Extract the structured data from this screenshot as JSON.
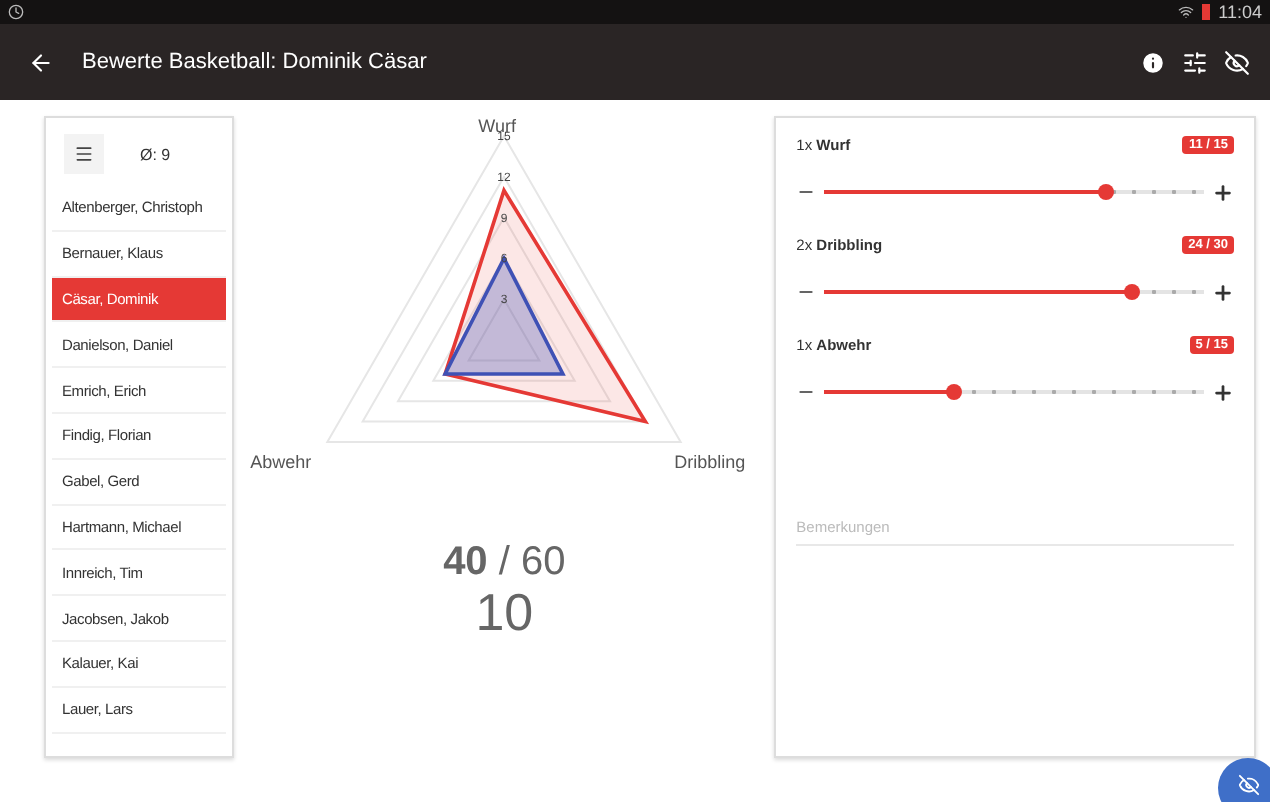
{
  "status_bar": {
    "time": "11:04"
  },
  "app_bar": {
    "title": "Bewerte Basketball: Dominik Cäsar"
  },
  "student_list": {
    "average": "Ø: 9",
    "students": [
      {
        "name": "Altenberger, Christoph",
        "selected": false
      },
      {
        "name": "Bernauer, Klaus",
        "selected": false
      },
      {
        "name": "Cäsar, Dominik",
        "selected": true
      },
      {
        "name": "Danielson, Daniel",
        "selected": false
      },
      {
        "name": "Emrich, Erich",
        "selected": false
      },
      {
        "name": "Findig, Florian",
        "selected": false
      },
      {
        "name": "Gabel, Gerd",
        "selected": false
      },
      {
        "name": "Hartmann, Michael",
        "selected": false
      },
      {
        "name": "Innreich, Tim",
        "selected": false
      },
      {
        "name": "Jacobsen, Jakob",
        "selected": false
      },
      {
        "name": "Kalauer, Kai",
        "selected": false
      },
      {
        "name": "Lauer, Lars",
        "selected": false
      }
    ]
  },
  "chart_data": {
    "type": "radar",
    "categories": [
      "Wurf",
      "Dribbling",
      "Abwehr"
    ],
    "yticks": [
      3,
      6,
      9,
      12,
      15
    ],
    "ylim": [
      0,
      15
    ],
    "series": [
      {
        "color": "#e53935",
        "values": [
          11,
          12,
          5
        ]
      },
      {
        "color": "#3f51b5",
        "values": [
          6,
          5,
          5
        ]
      }
    ]
  },
  "total": {
    "points": "**40** / 60",
    "grade": "10"
  },
  "criteria": [
    {
      "label": "1x **Wurf**",
      "score": "11 / 15",
      "level": 0.74
    },
    {
      "label": "2x **Dribbling**",
      "score": "24 / 30",
      "level": 0.81
    },
    {
      "label": "1x **Abwehr**",
      "score": "5 / 15",
      "level": 0.34
    }
  ],
  "notes": {
    "placeholder": "Bemerkungen"
  }
}
